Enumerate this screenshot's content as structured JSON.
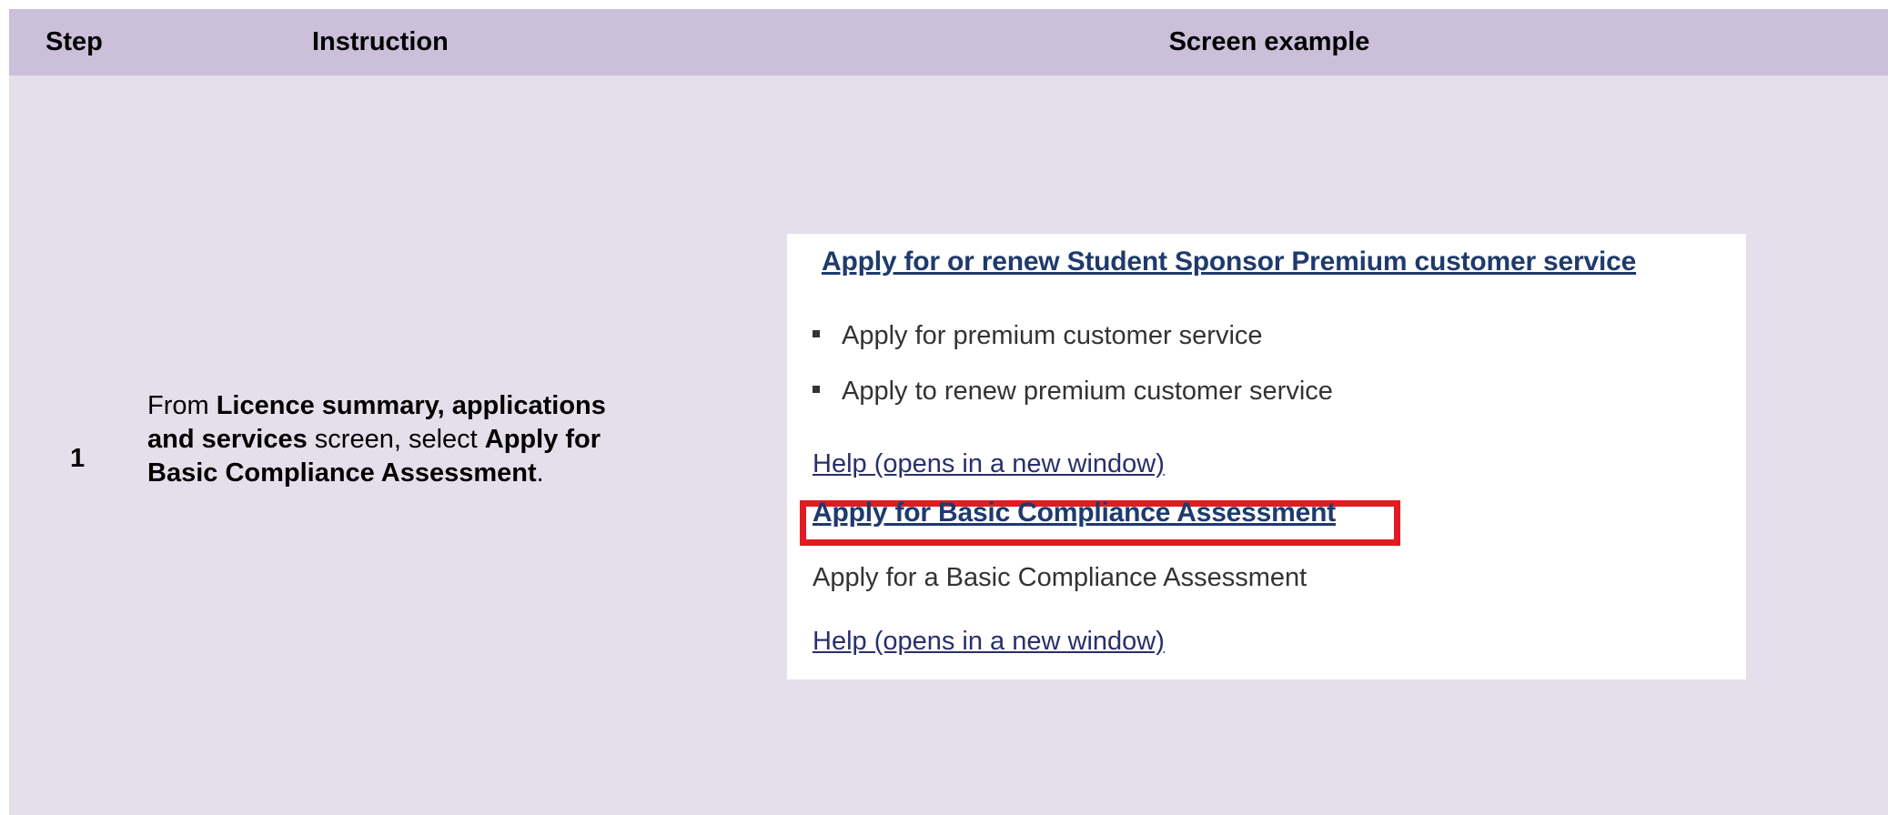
{
  "table": {
    "headers": {
      "step": "Step",
      "instruction": "Instruction",
      "screen_example": "Screen example"
    },
    "rows": [
      {
        "step": "1",
        "instruction": {
          "p1": "From ",
          "b1": "Licence summary, applications and services",
          "p2": " screen, select ",
          "b2": "Apply for Basic Compliance Assessment",
          "p3": "."
        }
      }
    ]
  },
  "screen": {
    "premium_heading_link": "Apply for or renew Student Sponsor Premium customer service",
    "premium_items": [
      "Apply for premium customer service",
      "Apply to renew premium customer service"
    ],
    "premium_help_link": "Help (opens in a new window)",
    "bca_link": "Apply for Basic Compliance Assessment",
    "bca_description": "Apply for a Basic Compliance Assessment",
    "bca_help_link": "Help (opens in a new window)",
    "highlight_color": "#e21b22",
    "link_color": "#1f3a6d"
  }
}
